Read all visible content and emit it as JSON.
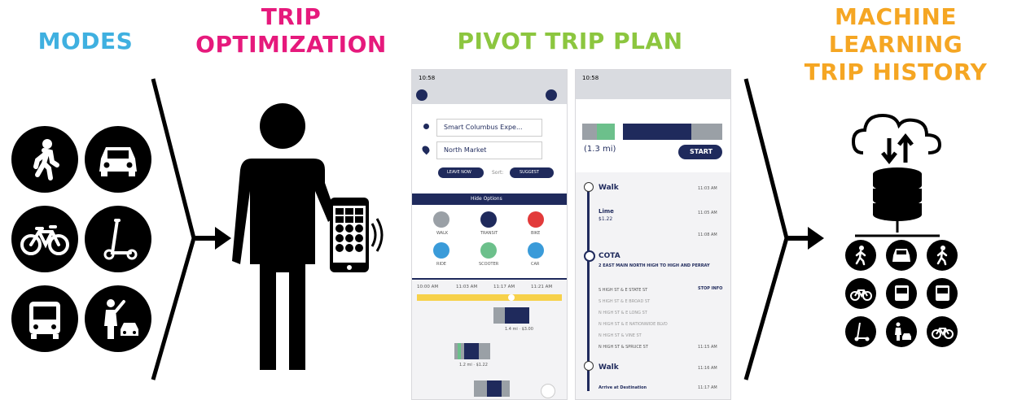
{
  "headings": {
    "modes": "MODES",
    "trip_optimization": [
      "TRIP",
      "OPTIMIZATION"
    ],
    "pivot_trip_plan": "PIVOT TRIP PLAN",
    "machine_learning": [
      "MACHINE LEARNING",
      "TRIP HISTORY"
    ]
  },
  "colors": {
    "modes": "#3fb0e0",
    "trip_optimization": "#e6197c",
    "pivot_trip_plan": "#8cc63f",
    "machine_learning": "#f5a623",
    "app_navy": "#1f2a5c"
  },
  "modes_icons": [
    "walk-icon",
    "car-icon",
    "bike-icon",
    "scooter-icon",
    "bus-icon",
    "rideshare-icon"
  ],
  "phone_left": {
    "status_time": "10:58",
    "origin": "Smart Columbus Expe...",
    "destination": "North Market",
    "leave_now": "LEAVE NOW",
    "sort_label": "Sort:",
    "sort_value": "SUGGEST",
    "hide_options": "Hide Options",
    "modes": [
      "WALK",
      "TRANSIT",
      "BIKE",
      "RIDE",
      "SCOOTER",
      "CAR"
    ],
    "times": [
      "10:00 AM",
      "11:03 AM",
      "11:17 AM",
      "11:21 AM"
    ],
    "trip_a": "1.4 mi · $3.00",
    "trip_b": "1.2 mi · $1.22"
  },
  "phone_right": {
    "status_time": "10:58",
    "distance": "(1.3 mi)",
    "start": "START",
    "steps": [
      "Walk",
      "Lime",
      "$1.22",
      "COTA",
      "2 EAST MAIN NORTH HIGH TO HIGH AND PERRAY",
      "Walk",
      "Arrive at Destination"
    ],
    "stops": [
      "S HIGH ST & E STATE ST",
      "S HIGH ST & E BROAD ST",
      "N HIGH ST & E LONG ST",
      "N HIGH ST & E NATIONWIDE BLVD",
      "N HIGH ST & VINE ST",
      "N HIGH ST & SPRUCE ST"
    ],
    "step_times": [
      "11:03 AM",
      "11:05 AM",
      "11:08 AM",
      "11:15 AM",
      "11:16 AM",
      "11:17 AM"
    ],
    "stop_link": "STOP INFO"
  },
  "ml_icons": [
    "cloud-sync-icon",
    "database-icon",
    "walk-icon",
    "car-icon",
    "walk-icon",
    "bike-icon",
    "bus-icon",
    "bus-icon",
    "scooter-icon",
    "rideshare-icon",
    "bike-icon"
  ]
}
